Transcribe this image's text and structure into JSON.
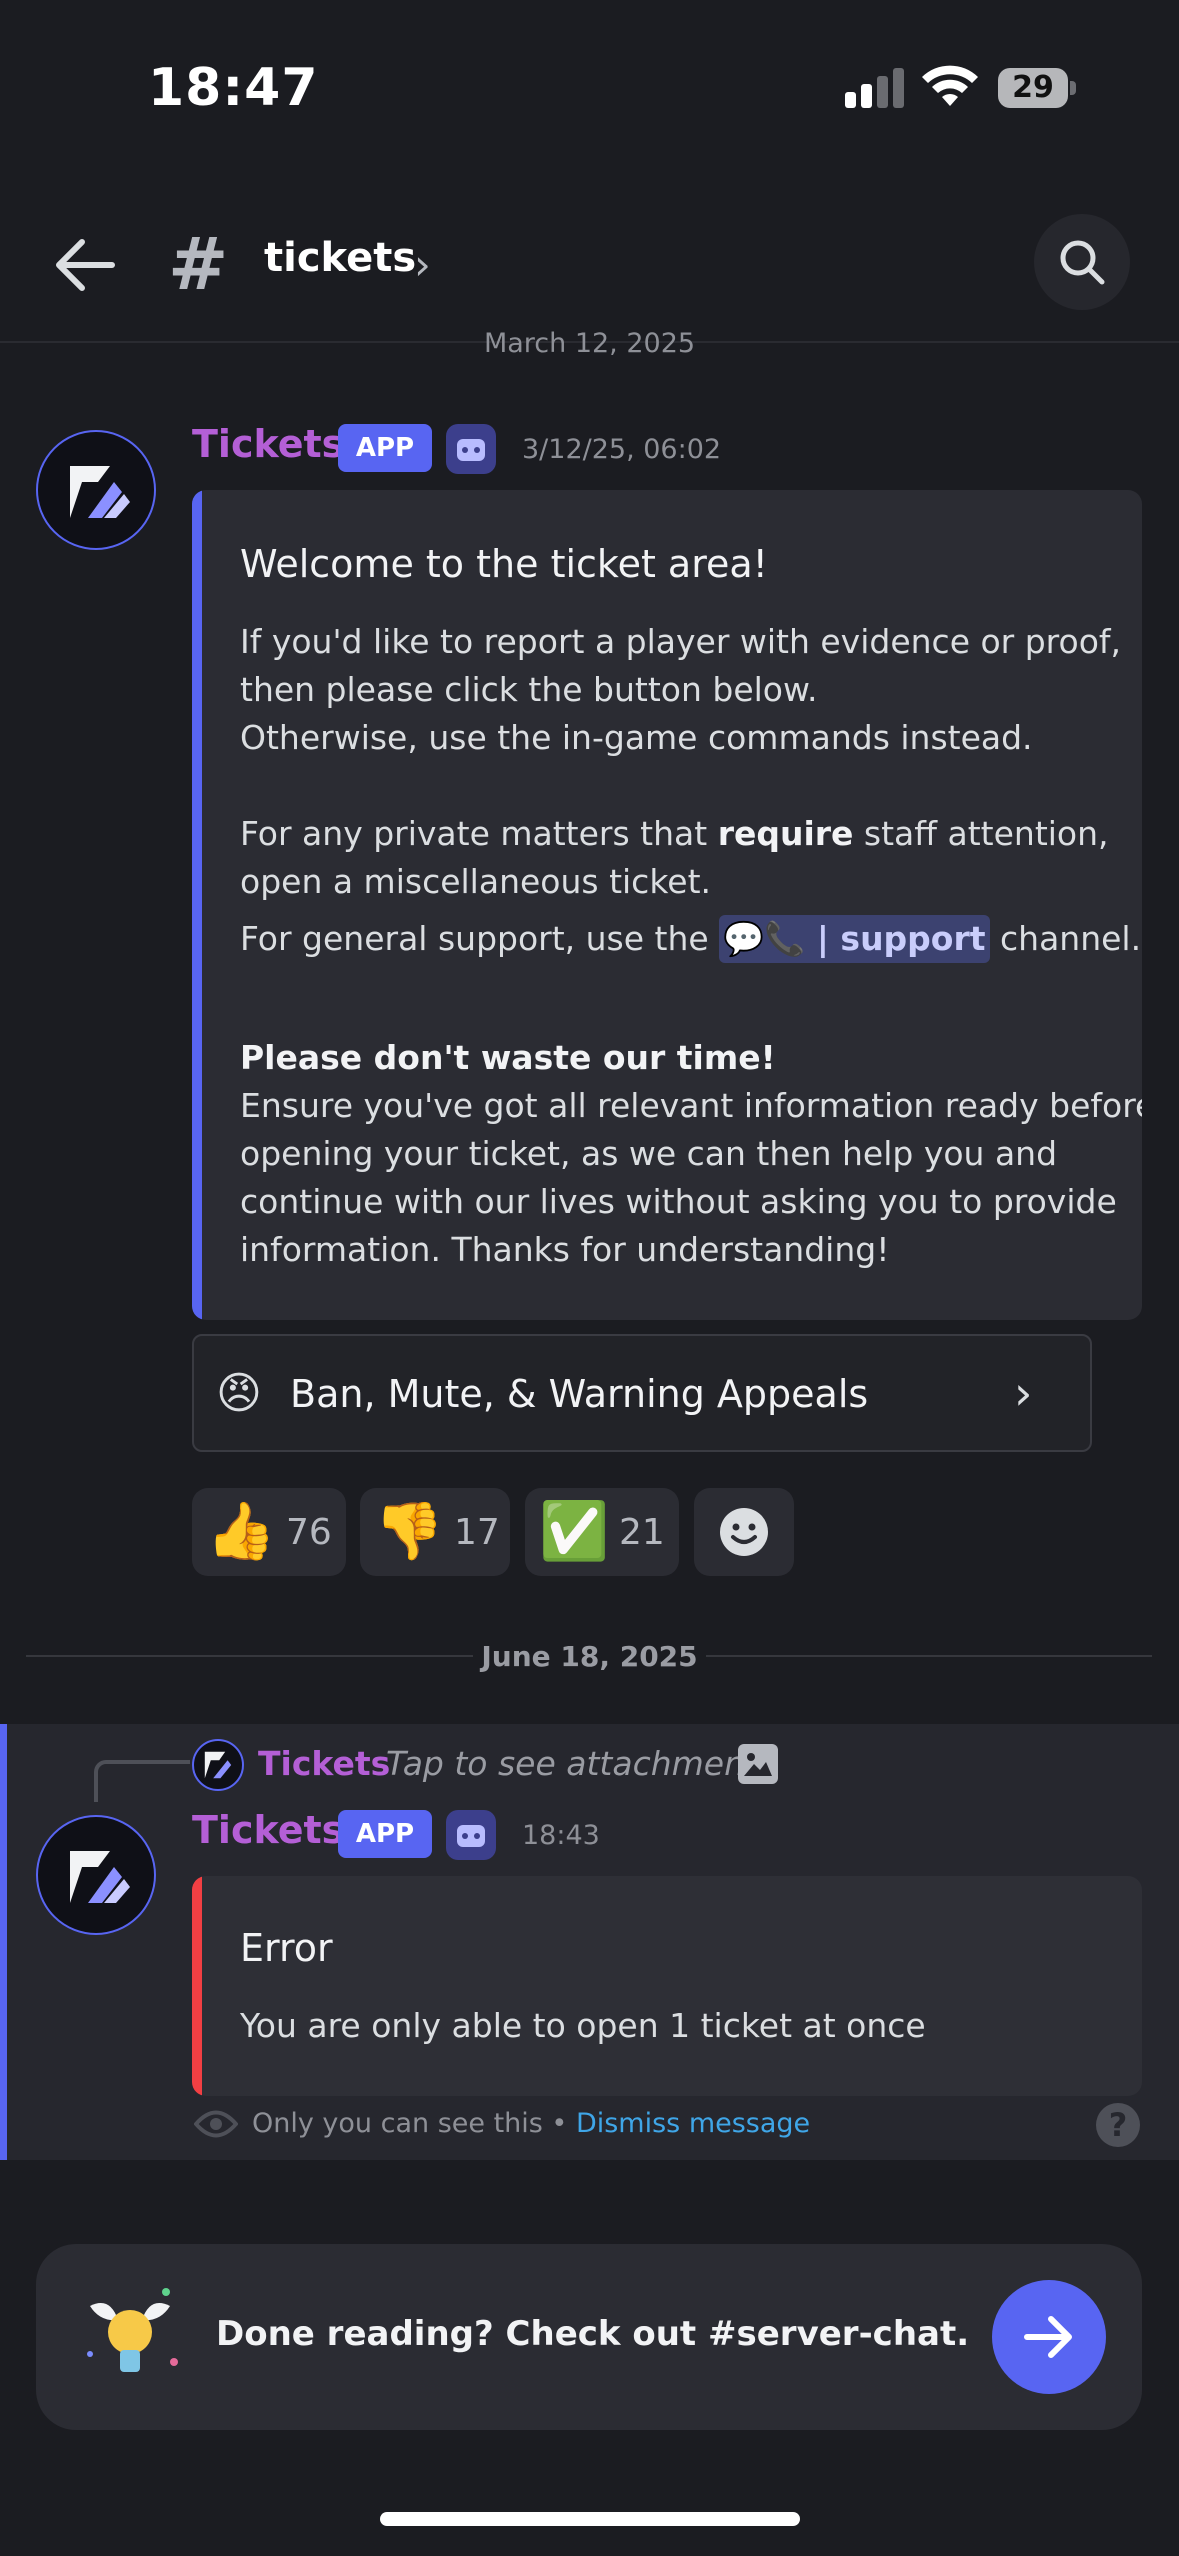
{
  "status_bar": {
    "time": "18:47",
    "battery": "29"
  },
  "header": {
    "channel_name": "tickets"
  },
  "messages": {
    "date_partial": "March 12, 2025",
    "first": {
      "author": "Tickets",
      "badge": "APP",
      "timestamp": "3/12/25, 06:02",
      "embed": {
        "title": "Welcome to the ticket area!",
        "p1_lines": [
          "If you'd like to report a player with evidence or proof,",
          "then please click the button below.",
          "Otherwise, use the in-game commands instead."
        ],
        "p2_pre": "For any private matters that ",
        "p2_bold": "require",
        "p2_post": " staff attention,",
        "p2_line2": "open a miscellaneous ticket.",
        "p3_pre": "For general support, use the ",
        "p3_mention": "support",
        "p3_post": " channel.",
        "p4_bold": "Please don't waste our time!",
        "p4_lines": [
          "Ensure you've got all relevant information ready before",
          "opening your ticket, as we can then help you and",
          "continue with our lives without asking you to provide",
          "information. Thanks for understanding!"
        ]
      },
      "select_label": "Ban, Mute, & Warning Appeals",
      "reactions": [
        {
          "emoji": "👍",
          "count": "76"
        },
        {
          "emoji": "👎",
          "count": "17"
        },
        {
          "emoji": "✅",
          "count": "21"
        }
      ]
    },
    "date_divider": "June 18, 2025",
    "second": {
      "reply_author": "Tickets",
      "reply_text": "Tap to see attachment",
      "author": "Tickets",
      "badge": "APP",
      "timestamp": "18:43",
      "embed": {
        "title": "Error",
        "text": "You are only able to open 1 ticket at once"
      },
      "note_text": "Only you can see this • ",
      "note_link": "Dismiss message"
    }
  },
  "prompt": {
    "text": "Done reading? Check out #server-chat."
  },
  "colors": {
    "accent": "#5865f2",
    "author": "#b45fd6",
    "error": "#f23f43",
    "link": "#3fa6e8"
  }
}
